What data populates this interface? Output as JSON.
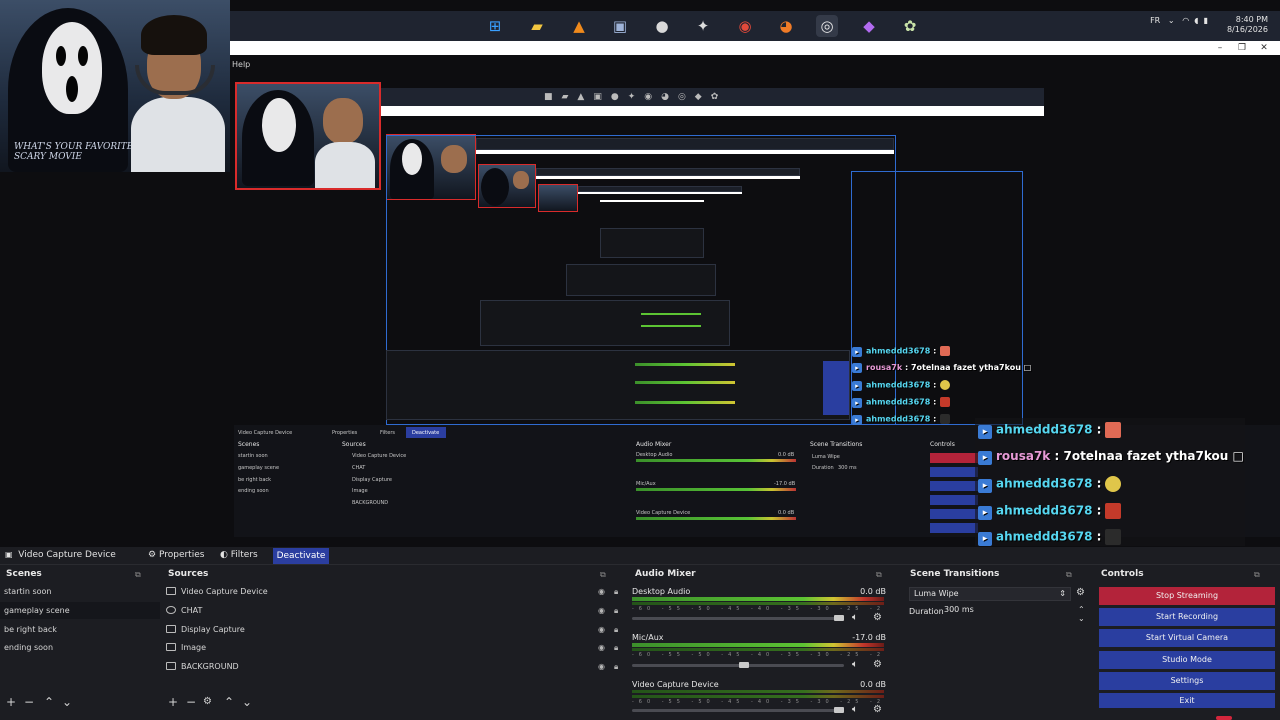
{
  "taskbar": {
    "icons": [
      "windows-icon",
      "file-explorer-icon",
      "vlc-icon",
      "remote-desktop-icon",
      "globe-icon",
      "utility-icon",
      "chrome-icon",
      "firefox-icon",
      "obs-icon",
      "app-icon",
      "app-icon-2"
    ],
    "tray_lang": "FR",
    "time": "8:40 PM",
    "date": "8/16/2026"
  },
  "window": {
    "help_menu": "Help"
  },
  "webcam": {
    "poster_text": "WHAT'S YOUR FAVORITE SCARY MOVIE"
  },
  "chat": {
    "messages": [
      {
        "user": "ahmeddd3678",
        "text": ""
      },
      {
        "user": "rousa7k",
        "text": "7otelnaa fazet ytha7kou"
      },
      {
        "user": "ahmeddd3678",
        "text": ""
      },
      {
        "user": "ahmeddd3678",
        "text": ""
      },
      {
        "user": "ahmeddd3678",
        "text": ""
      }
    ],
    "separator": ":",
    "trailing_glyph": "□",
    "emoji_colors": [
      "#e06a55",
      "#e0c64a",
      "#c43a2a",
      "#2b2b2b"
    ]
  },
  "mirror": {
    "source_name": "Video Capture Device",
    "properties": "Properties",
    "filters": "Filters",
    "deactivate": "Deactivate",
    "scenes_title": "Scenes",
    "sources_title": "Sources",
    "audio_title": "Audio Mixer",
    "transitions_title": "Scene Transitions",
    "controls_title": "Controls",
    "scenes": [
      "startin soon",
      "gameplay scene",
      "be right back",
      "ending soon"
    ],
    "sources": [
      "Video Capture Device",
      "CHAT",
      "Display Capture",
      "Image",
      "BACKGROUND"
    ],
    "audio": [
      {
        "name": "Desktop Audio",
        "db": "0.0 dB"
      },
      {
        "name": "Mic/Aux",
        "db": "-17.0 dB"
      },
      {
        "name": "Video Capture Device",
        "db": "0.0 dB"
      }
    ],
    "transition": "Luma Wipe",
    "duration_label": "Duration",
    "duration_value": "300 ms"
  },
  "obs": {
    "toolbar": {
      "source_name": "Video Capture Device",
      "properties": "Properties",
      "filters": "Filters",
      "deactivate": "Deactivate"
    },
    "scenes": {
      "title": "Scenes",
      "items": [
        "startin soon",
        "gameplay scene",
        "be right back",
        "ending soon"
      ],
      "selected_index": 1
    },
    "sources": {
      "title": "Sources",
      "items": [
        {
          "name": "Video Capture Device",
          "icon": "camera-icon"
        },
        {
          "name": "CHAT",
          "icon": "browser-icon"
        },
        {
          "name": "Display Capture",
          "icon": "monitor-icon"
        },
        {
          "name": "Image",
          "icon": "image-icon"
        },
        {
          "name": "BACKGROUND",
          "icon": "image-icon"
        }
      ]
    },
    "audio_mixer": {
      "title": "Audio Mixer",
      "tick_labels": "-60 -55 -50 -45 -40 -35 -30 -25 -20 -15 -10 -5 0",
      "channels": [
        {
          "name": "Desktop Audio",
          "db": "0.0 dB",
          "volume": 1.0
        },
        {
          "name": "Mic/Aux",
          "db": "-17.0 dB",
          "volume": 0.53
        },
        {
          "name": "Video Capture Device",
          "db": "0.0 dB",
          "volume": 1.0
        }
      ]
    },
    "scene_transitions": {
      "title": "Scene Transitions",
      "transition": "Luma Wipe",
      "duration_label": "Duration",
      "duration_value": "300 ms"
    },
    "controls": {
      "title": "Controls",
      "buttons": [
        "Stop Streaming",
        "Start Recording",
        "Start Virtual Camera",
        "Studio Mode",
        "Settings",
        "Exit"
      ]
    }
  },
  "colors": {
    "accent_blue": "#2b3ea0",
    "stop_red": "#b3233a",
    "chat_user": "#56d6f0",
    "chat_user2": "#e79ad6",
    "selection_red": "#d92b2b"
  }
}
